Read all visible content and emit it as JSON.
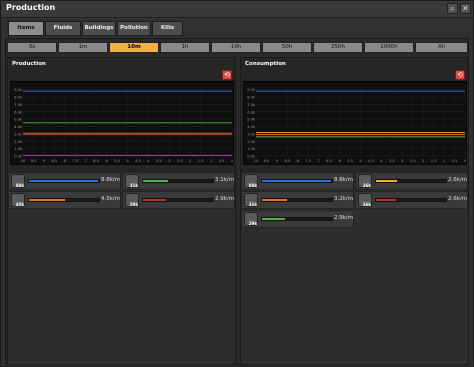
{
  "window": {
    "title": "Production"
  },
  "icons": {
    "search": "search-icon",
    "close": "close-icon",
    "reset": "reset-icon"
  },
  "tabs": [
    {
      "label": "Items",
      "active": true
    },
    {
      "label": "Fluids",
      "active": false
    },
    {
      "label": "Buildings",
      "active": false
    },
    {
      "label": "Pollution",
      "active": false
    },
    {
      "label": "Kills",
      "active": false
    }
  ],
  "time_ranges": [
    {
      "label": "5s",
      "active": false
    },
    {
      "label": "1m",
      "active": false
    },
    {
      "label": "10m",
      "active": true
    },
    {
      "label": "1h",
      "active": false
    },
    {
      "label": "10h",
      "active": false
    },
    {
      "label": "50h",
      "active": false
    },
    {
      "label": "250h",
      "active": false
    },
    {
      "label": "1000h",
      "active": false
    },
    {
      "label": "All",
      "active": false
    }
  ],
  "production": {
    "title": "Production",
    "y_ticks": [
      "9.0k",
      "8.0k",
      "7.0k",
      "6.0k",
      "5.0k",
      "4.0k",
      "3.0k",
      "2.0k",
      "1.0k",
      "0.0k"
    ],
    "x_ticks": [
      "10",
      "9.5",
      "9",
      "8.5",
      "8",
      "7.5",
      "7",
      "6.5",
      "6",
      "5.5",
      "5",
      "4.5",
      "4",
      "3.5",
      "3",
      "2.5",
      "2",
      "1.5",
      "1",
      "0.5",
      "0"
    ],
    "series_y": [
      8.8,
      4.5,
      3.1,
      2.9,
      0.1
    ],
    "items": [
      {
        "icon": "iron-plate-icon",
        "count": "88k",
        "rate": "8.8k/m",
        "color": "#2f73e0",
        "fill": 0.98
      },
      {
        "icon": "copper-plate-icon",
        "count": "31k",
        "rate": "3.1k/m",
        "color": "#4fb34f",
        "fill": 0.35
      },
      {
        "icon": "circuit-icon",
        "count": "45k",
        "rate": "4.5k/m",
        "color": "#e5761f",
        "fill": 0.51
      },
      {
        "icon": "stone-brick-icon",
        "count": "29k",
        "rate": "2.9k/m",
        "color": "#c0322c",
        "fill": 0.33
      }
    ]
  },
  "consumption": {
    "title": "Consumption",
    "y_ticks": [
      "9.0k",
      "8.0k",
      "7.0k",
      "6.0k",
      "5.0k",
      "4.0k",
      "3.0k",
      "2.0k",
      "1.0k",
      "0.0k"
    ],
    "x_ticks": [
      "10",
      "9.5",
      "9",
      "8.5",
      "8",
      "7.5",
      "7",
      "6.5",
      "6",
      "5.5",
      "5",
      "4.5",
      "4",
      "3.5",
      "3",
      "2.5",
      "2",
      "1.5",
      "1",
      "0.5",
      "0"
    ],
    "series_y": [
      8.8,
      3.2,
      2.9,
      2.6,
      2.6
    ],
    "items": [
      {
        "icon": "iron-plate-icon",
        "count": "88k",
        "rate": "8.8k/m",
        "color": "#2f73e0",
        "fill": 0.98
      },
      {
        "icon": "gear-icon",
        "count": "26k",
        "rate": "2.6k/m",
        "color": "#f0b01a",
        "fill": 0.3
      },
      {
        "icon": "copper-plate-icon",
        "count": "31k",
        "rate": "3.2k/m",
        "color": "#e5761f",
        "fill": 0.36
      },
      {
        "icon": "engine-icon",
        "count": "26k",
        "rate": "2.6k/m",
        "color": "#c0322c",
        "fill": 0.29
      },
      {
        "icon": "stone-brick-icon",
        "count": "29k",
        "rate": "2.9k/m",
        "color": "#4fb34f",
        "fill": 0.33
      }
    ]
  }
}
